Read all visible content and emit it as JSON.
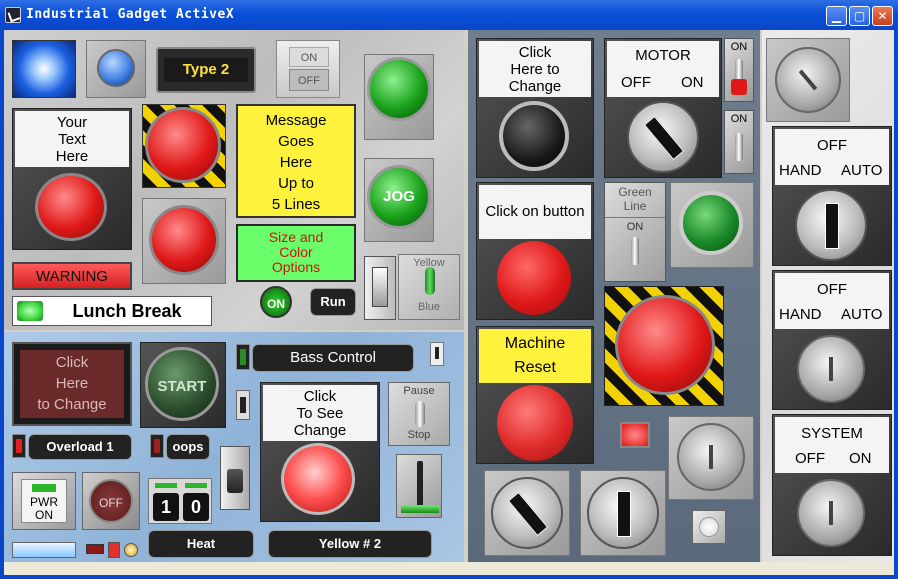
{
  "window": {
    "title": "Industrial Gadget ActiveX",
    "minimize": "▁",
    "maximize": "▢",
    "close": "✕"
  },
  "top_left": {
    "type2": "Type 2",
    "onoff_on": "ON",
    "onoff_off": "OFF",
    "your_text": [
      "Your",
      "Text",
      "Here"
    ],
    "message": [
      "Message",
      "Goes",
      "Here",
      "Up to",
      "5 Lines"
    ],
    "size_color": [
      "Size and",
      "Color",
      "Options"
    ],
    "jog": "JOG",
    "warning": "WARNING",
    "lunch": "Lunch Break",
    "on_badge": "ON",
    "run": "Run",
    "yellow": "Yellow",
    "blue": "Blue"
  },
  "bottom_left": {
    "click_here": [
      "Click",
      "Here",
      "to Change"
    ],
    "start": "START",
    "bass": "Bass Control",
    "click_see": [
      "Click",
      "To See",
      "Change"
    ],
    "pause": "Pause",
    "stop": "Stop",
    "overload": "Overload 1",
    "oops": "oops",
    "pwr": [
      "PWR",
      "ON"
    ],
    "off": "OFF",
    "digits": [
      "1",
      "0"
    ],
    "heat": "Heat",
    "yellow2": "Yellow # 2"
  },
  "middle": {
    "click_change": [
      "Click",
      "Here to",
      "Change"
    ],
    "motor": "MOTOR",
    "motor_off": "OFF",
    "motor_on": "ON",
    "sw_on1": "ON",
    "sw_on2": "ON",
    "green_line": [
      "Green",
      "Line"
    ],
    "green_on": "ON",
    "click_on_button": "Click on button",
    "machine_reset": [
      "Machine",
      "Reset"
    ]
  },
  "right": {
    "off1": "OFF",
    "hand1": "HAND",
    "auto1": "AUTO",
    "off2": "OFF",
    "hand2": "HAND",
    "auto2": "AUTO",
    "system": "SYSTEM",
    "sys_off": "OFF",
    "sys_on": "ON"
  },
  "colors": {
    "titlebar": "#0a46c8",
    "yellow_label": "#fff23c",
    "warning_red": "#e03030",
    "led_green": "#3cd63c"
  }
}
